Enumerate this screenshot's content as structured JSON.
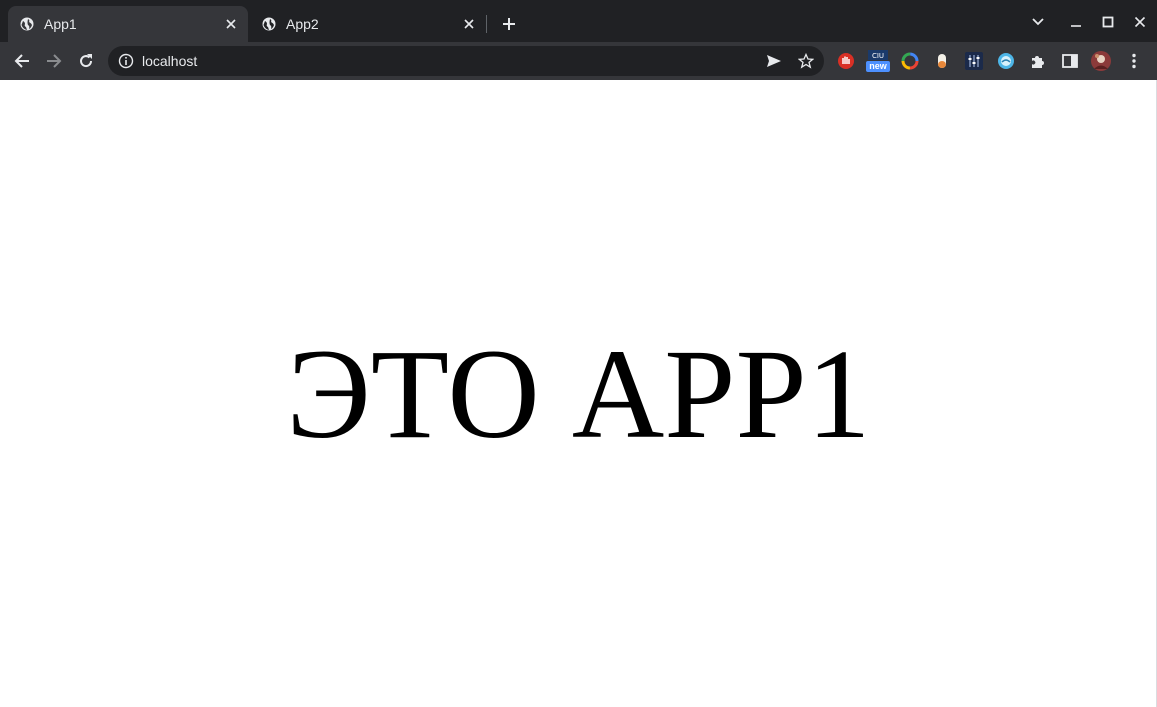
{
  "tabs": [
    {
      "title": "App1",
      "active": true
    },
    {
      "title": "App2",
      "active": false
    }
  ],
  "address_bar": {
    "url": "localhost"
  },
  "page": {
    "headline": "ЭТО APP1"
  },
  "extensions": [
    {
      "icon": "hand-stop-icon"
    },
    {
      "icon": "new-badge-icon",
      "badge": "new"
    },
    {
      "icon": "color-ring-icon"
    },
    {
      "icon": "pill-icon"
    },
    {
      "icon": "equalizer-icon"
    },
    {
      "icon": "cloud-globe-icon"
    },
    {
      "icon": "puzzle-icon"
    },
    {
      "icon": "side-panel-icon"
    },
    {
      "icon": "profile-avatar-icon"
    },
    {
      "icon": "kebab-menu-icon"
    }
  ],
  "colors": {
    "frame": "#202124",
    "toolbar": "#35363a",
    "text": "#e8eaed"
  }
}
